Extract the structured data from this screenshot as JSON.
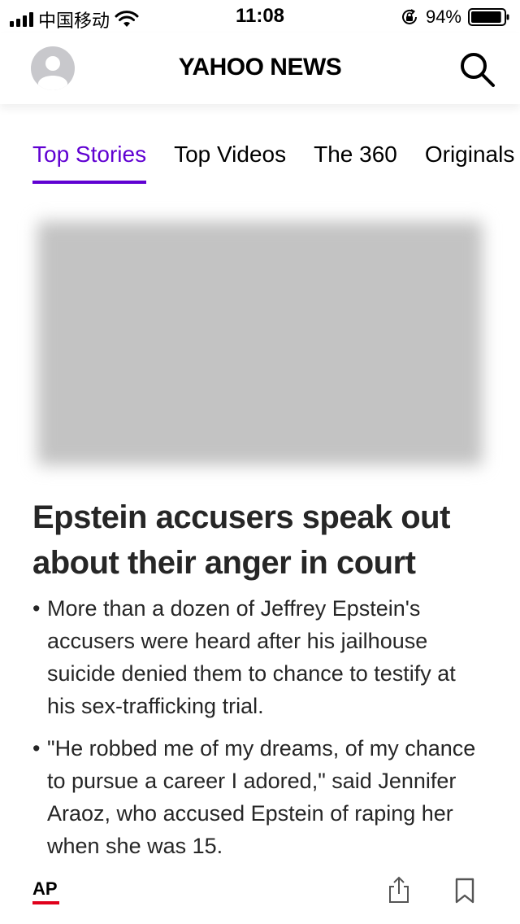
{
  "status_bar": {
    "carrier": "中国移动",
    "time": "11:08",
    "battery_percent": "94%",
    "battery_level": 0.94,
    "icons": [
      "signal-icon",
      "wifi-icon",
      "orientation-lock-icon",
      "battery-icon"
    ]
  },
  "header": {
    "brand": "YAHOO NEWS",
    "avatar_icon": "user-avatar-icon",
    "search_icon": "search-icon"
  },
  "tabs": [
    {
      "label": "Top Stories",
      "active": true
    },
    {
      "label": "Top Videos",
      "active": false
    },
    {
      "label": "The 360",
      "active": false
    },
    {
      "label": "Originals",
      "active": false
    }
  ],
  "story": {
    "headline": "Epstein accusers speak out about their anger in court",
    "bullets": [
      "More than a dozen of Jeffrey Epstein's accusers were heard after his jailhouse suicide denied them to chance to testify at his sex-trafficking trial.",
      "\"He robbed me of my dreams, of my chance to pursue a career I adored,\" said Jennifer Araoz, who accused Epstein of raping her when she was 15."
    ],
    "source": "AP",
    "actions": [
      "share-icon",
      "bookmark-icon"
    ]
  },
  "colors": {
    "accent": "#6001d2",
    "ap_underline": "#e0001b",
    "text": "#262626"
  }
}
